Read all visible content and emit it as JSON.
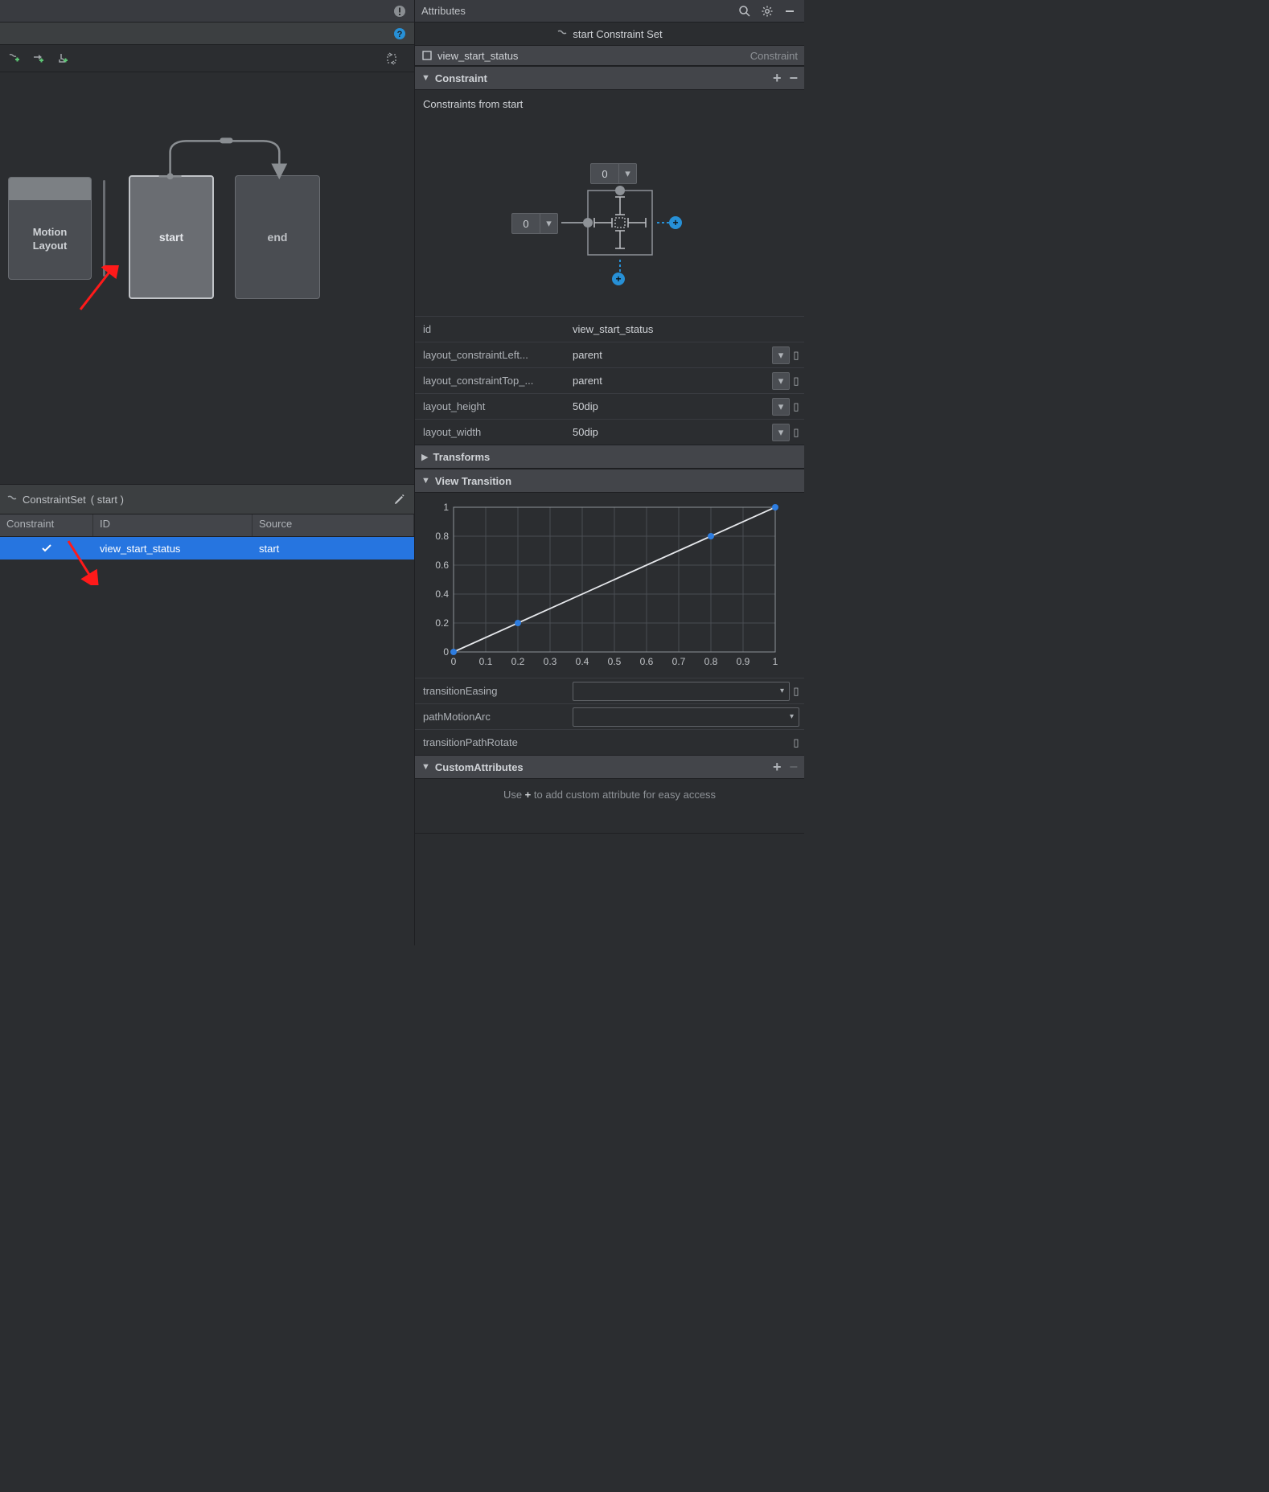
{
  "attributes_panel": {
    "title": "Attributes",
    "sub_title": "start Constraint Set",
    "crumb_view": "view_start_status",
    "crumb_kind": "Constraint"
  },
  "motion_editor": {
    "ml_label": "Motion\nLayout",
    "start_label": "start",
    "end_label": "end"
  },
  "constraint_set_panel": {
    "title_prefix": "ConstraintSet",
    "title_paren": "(  start  )",
    "columns": {
      "constraint": "Constraint",
      "id": "ID",
      "source": "Source"
    },
    "row": {
      "id": "view_start_status",
      "source": "start"
    }
  },
  "constraint_section": {
    "title": "Constraint",
    "subtitle": "Constraints from start",
    "widget_top": "0",
    "widget_left": "0",
    "attrs": {
      "id_k": "id",
      "id_v": "view_start_status",
      "left_k": "layout_constraintLeft...",
      "left_v": "parent",
      "top_k": "layout_constraintTop_...",
      "top_v": "parent",
      "h_k": "layout_height",
      "h_v": "50dip",
      "w_k": "layout_width",
      "w_v": "50dip"
    }
  },
  "transforms_section": {
    "title": "Transforms"
  },
  "view_transition_section": {
    "title": "View Transition",
    "easing_k": "transitionEasing",
    "easing_v": "",
    "arc_k": "pathMotionArc",
    "arc_v": "",
    "rotate_k": "transitionPathRotate",
    "rotate_v": ""
  },
  "custom_section": {
    "title": "CustomAttributes",
    "hint_pre": "Use ",
    "hint_plus": "+",
    "hint_post": " to add custom attribute for easy access"
  },
  "chart_data": {
    "type": "line",
    "x": [
      0,
      0.2,
      0.8,
      1.0
    ],
    "y": [
      0,
      0.2,
      0.8,
      1.0
    ],
    "xlabel": "",
    "ylabel": "",
    "xlim": [
      0,
      1
    ],
    "ylim": [
      0,
      1
    ],
    "xticks": [
      0,
      0.1,
      0.2,
      0.3,
      0.4,
      0.5,
      0.6,
      0.7,
      0.8,
      0.9,
      1
    ],
    "yticks": [
      0,
      0.2,
      0.4,
      0.6,
      0.8,
      1
    ]
  }
}
